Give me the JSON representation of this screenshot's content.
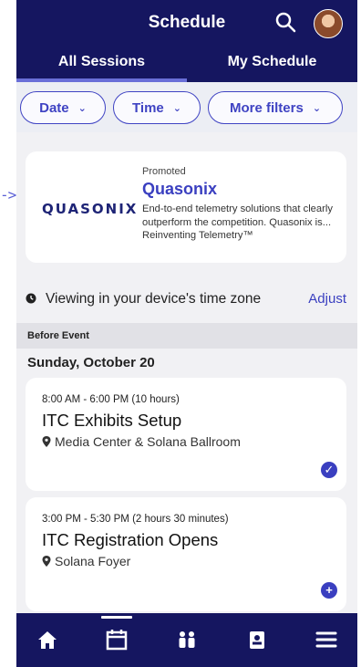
{
  "header": {
    "title": "Schedule"
  },
  "tabs": [
    {
      "label": "All Sessions",
      "active": true
    },
    {
      "label": "My Schedule",
      "active": false
    }
  ],
  "filters": [
    {
      "label": "Date"
    },
    {
      "label": "Time"
    },
    {
      "label": "More filters"
    }
  ],
  "promo": {
    "label": "Promoted",
    "name": "Quasonix",
    "logo_text": "QUASONIX",
    "description": "End-to-end telemetry solutions that clearly outperform the competition. Quasonix is... Reinventing Telemetry™"
  },
  "timezone": {
    "text": "Viewing in your device's time zone",
    "action": "Adjust"
  },
  "section": {
    "label": "Before Event",
    "day": "Sunday, October 20"
  },
  "sessions": [
    {
      "time": "8:00 AM - 6:00 PM (10 hours)",
      "title": "ITC Exhibits Setup",
      "location": "Media Center & Solana Ballroom",
      "status": "added"
    },
    {
      "time": "3:00 PM - 5:30 PM (2 hours 30 minutes)",
      "title": "ITC Registration Opens",
      "location": "Solana Foyer",
      "status": "add"
    }
  ],
  "bottom_nav": [
    {
      "icon": "home-icon",
      "active": false
    },
    {
      "icon": "calendar-icon",
      "active": true
    },
    {
      "icon": "people-icon",
      "active": false
    },
    {
      "icon": "badge-icon",
      "active": false
    },
    {
      "icon": "menu-icon",
      "active": false
    }
  ],
  "colors": {
    "nav_background": "#151660",
    "accent": "#3a3fc0",
    "page_background": "#f1f1f4"
  }
}
